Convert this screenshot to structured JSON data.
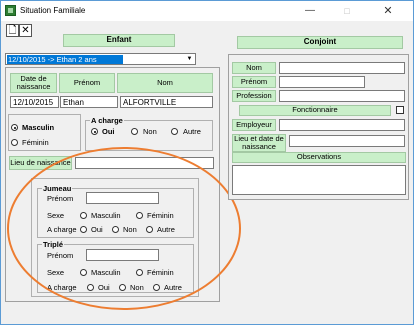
{
  "window": {
    "title": "Situation Familiale",
    "minimize": "—",
    "maximize": "□",
    "close": "✕"
  },
  "toolbar": {
    "new_icon": "new-document-icon",
    "new_glyph": "🗋",
    "delete_glyph": "✕"
  },
  "enfant": {
    "header": "Enfant",
    "selector": "12/10/2015 -> Ethan 2 ans",
    "dropdown_glyph": "▼",
    "col_date": "Date de naissance",
    "col_prenom": "Prénom",
    "col_nom": "Nom",
    "date_value": "12/10/2015",
    "prenom_value": "Ethan",
    "nom_value": "ALFORTVILLE",
    "sexe_masculin": "Masculin",
    "sexe_feminin": "Féminin",
    "a_charge_label": "A charge",
    "a_charge_oui": "Oui",
    "a_charge_non": "Non",
    "a_charge_autre": "Autre",
    "lieu_naissance_label": "Lieu de naissance",
    "lieu_naissance_value": ""
  },
  "jumeau": {
    "title": "Jumeau",
    "prenom_label": "Prénom",
    "sexe_label": "Sexe",
    "masculin": "Masculin",
    "feminin": "Féminin",
    "a_charge_label": "A charge",
    "oui": "Oui",
    "non": "Non",
    "autre": "Autre"
  },
  "triple": {
    "title": "Triplé",
    "prenom_label": "Prénom",
    "sexe_label": "Sexe",
    "masculin": "Masculin",
    "feminin": "Féminin",
    "a_charge_label": "A charge",
    "oui": "Oui",
    "non": "Non",
    "autre": "Autre"
  },
  "conjoint": {
    "header": "Conjoint",
    "nom_label": "Nom",
    "prenom_label": "Prénom",
    "profession_label": "Profession",
    "fonctionnaire_label": "Fonctionnaire",
    "employeur_label": "Employeur",
    "lieu_date_label": "Lieu et date de naissance",
    "observations_label": "Observations"
  },
  "colors": {
    "button_green": "#c9efc9",
    "selection_blue": "#0078d7",
    "annotation_orange": "#ed7d31"
  }
}
